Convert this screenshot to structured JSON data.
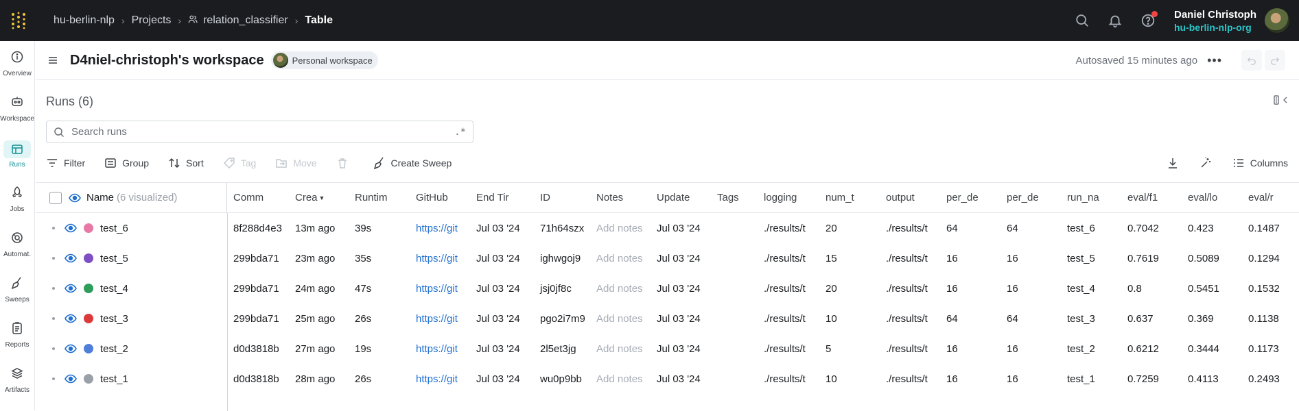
{
  "topbar": {
    "breadcrumbs": [
      {
        "label": "hu-berlin-nlp"
      },
      {
        "label": "Projects"
      },
      {
        "label": "relation_classifier"
      },
      {
        "label": "Table"
      }
    ],
    "user_name": "Daniel Christoph",
    "user_org": "hu-berlin-nlp-org"
  },
  "leftnav": {
    "items": [
      {
        "label": "Overview",
        "icon": "info-icon"
      },
      {
        "label": "Workspace",
        "icon": "robot-icon"
      },
      {
        "label": "Runs",
        "icon": "table-icon",
        "active": true
      },
      {
        "label": "Jobs",
        "icon": "rocket-icon"
      },
      {
        "label": "Automat.",
        "icon": "automation-icon"
      },
      {
        "label": "Sweeps",
        "icon": "broom-icon"
      },
      {
        "label": "Reports",
        "icon": "report-icon"
      },
      {
        "label": "Artifacts",
        "icon": "layers-icon"
      }
    ]
  },
  "workspace": {
    "title": "D4niel-christoph's workspace",
    "badge": "Personal workspace",
    "autosave": "Autosaved 15 minutes ago"
  },
  "runs": {
    "title": "Runs (6)",
    "search_placeholder": "Search runs",
    "regex": ".*"
  },
  "toolbar": {
    "filter": "Filter",
    "group": "Group",
    "sort": "Sort",
    "tag": "Tag",
    "move": "Move",
    "create_sweep": "Create Sweep",
    "columns": "Columns"
  },
  "table": {
    "name_header": "Name",
    "visualized": "(6 visualized)",
    "headers": [
      "Comm",
      "Crea",
      "Runtim",
      "GitHub",
      "End Tir",
      "ID",
      "Notes",
      "Update",
      "Tags",
      "logging",
      "num_t",
      "output",
      "per_de",
      "per_de",
      "run_na",
      "eval/f1",
      "eval/lo",
      "eval/r"
    ],
    "rows": [
      {
        "name": "test_6",
        "color": "#e879a6",
        "cells": [
          "8f288d4e3",
          "13m ago",
          "39s",
          "https://git",
          "Jul 03 '24",
          "71h64szx",
          "Add notes",
          "Jul 03 '24",
          "",
          "./results/t",
          "20",
          "./results/t",
          "64",
          "64",
          "test_6",
          "0.7042",
          "0.423",
          "0.1487"
        ]
      },
      {
        "name": "test_5",
        "color": "#7e4fc4",
        "cells": [
          "299bda71",
          "23m ago",
          "35s",
          "https://git",
          "Jul 03 '24",
          "ighwgoj9",
          "Add notes",
          "Jul 03 '24",
          "",
          "./results/t",
          "15",
          "./results/t",
          "16",
          "16",
          "test_5",
          "0.7619",
          "0.5089",
          "0.1294"
        ]
      },
      {
        "name": "test_4",
        "color": "#2f9e5b",
        "cells": [
          "299bda71",
          "24m ago",
          "47s",
          "https://git",
          "Jul 03 '24",
          "jsj0jf8c",
          "Add notes",
          "Jul 03 '24",
          "",
          "./results/t",
          "20",
          "./results/t",
          "16",
          "16",
          "test_4",
          "0.8",
          "0.5451",
          "0.1532"
        ]
      },
      {
        "name": "test_3",
        "color": "#dc3a3a",
        "cells": [
          "299bda71",
          "25m ago",
          "26s",
          "https://git",
          "Jul 03 '24",
          "pgo2i7m9",
          "Add notes",
          "Jul 03 '24",
          "",
          "./results/t",
          "10",
          "./results/t",
          "64",
          "64",
          "test_3",
          "0.637",
          "0.369",
          "0.1138"
        ]
      },
      {
        "name": "test_2",
        "color": "#4f7fdb",
        "cells": [
          "d0d3818b",
          "27m ago",
          "19s",
          "https://git",
          "Jul 03 '24",
          "2l5et3jg",
          "Add notes",
          "Jul 03 '24",
          "",
          "./results/t",
          "5",
          "./results/t",
          "16",
          "16",
          "test_2",
          "0.6212",
          "0.3444",
          "0.1173"
        ]
      },
      {
        "name": "test_1",
        "color": "#9aa0a8",
        "cells": [
          "d0d3818b",
          "28m ago",
          "26s",
          "https://git",
          "Jul 03 '24",
          "wu0p9bb",
          "Add notes",
          "Jul 03 '24",
          "",
          "./results/t",
          "10",
          "./results/t",
          "16",
          "16",
          "test_1",
          "0.7259",
          "0.4113",
          "0.2493"
        ]
      }
    ]
  }
}
